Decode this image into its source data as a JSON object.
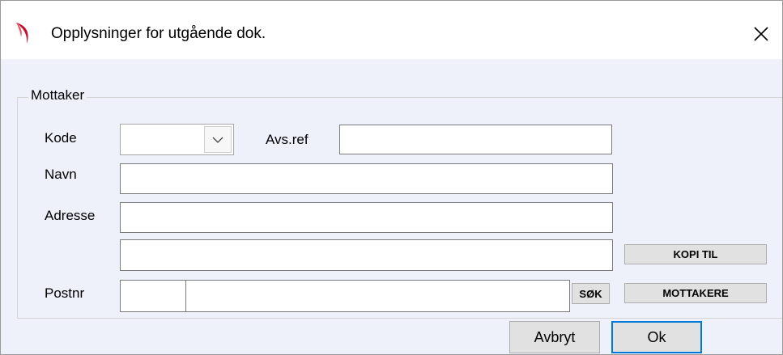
{
  "window": {
    "title": "Opplysninger for utgående dok.",
    "accent_color": "#0078d7",
    "icon": "app-logo-icon",
    "close_icon": "close-icon"
  },
  "group": {
    "legend": "Mottaker"
  },
  "fields": {
    "kode": {
      "label": "Kode",
      "value": ""
    },
    "avsref": {
      "label": "Avs.ref",
      "value": ""
    },
    "navn": {
      "label": "Navn",
      "value": ""
    },
    "adresse": {
      "label": "Adresse",
      "line1": "",
      "line2": ""
    },
    "postnr": {
      "label": "Postnr",
      "code": "",
      "place": ""
    }
  },
  "buttons": {
    "sok": "SØK",
    "kopi_til": "KOPI TIL",
    "mottakere": "MOTTAKERE",
    "avbryt": "Avbryt",
    "ok": "Ok"
  }
}
